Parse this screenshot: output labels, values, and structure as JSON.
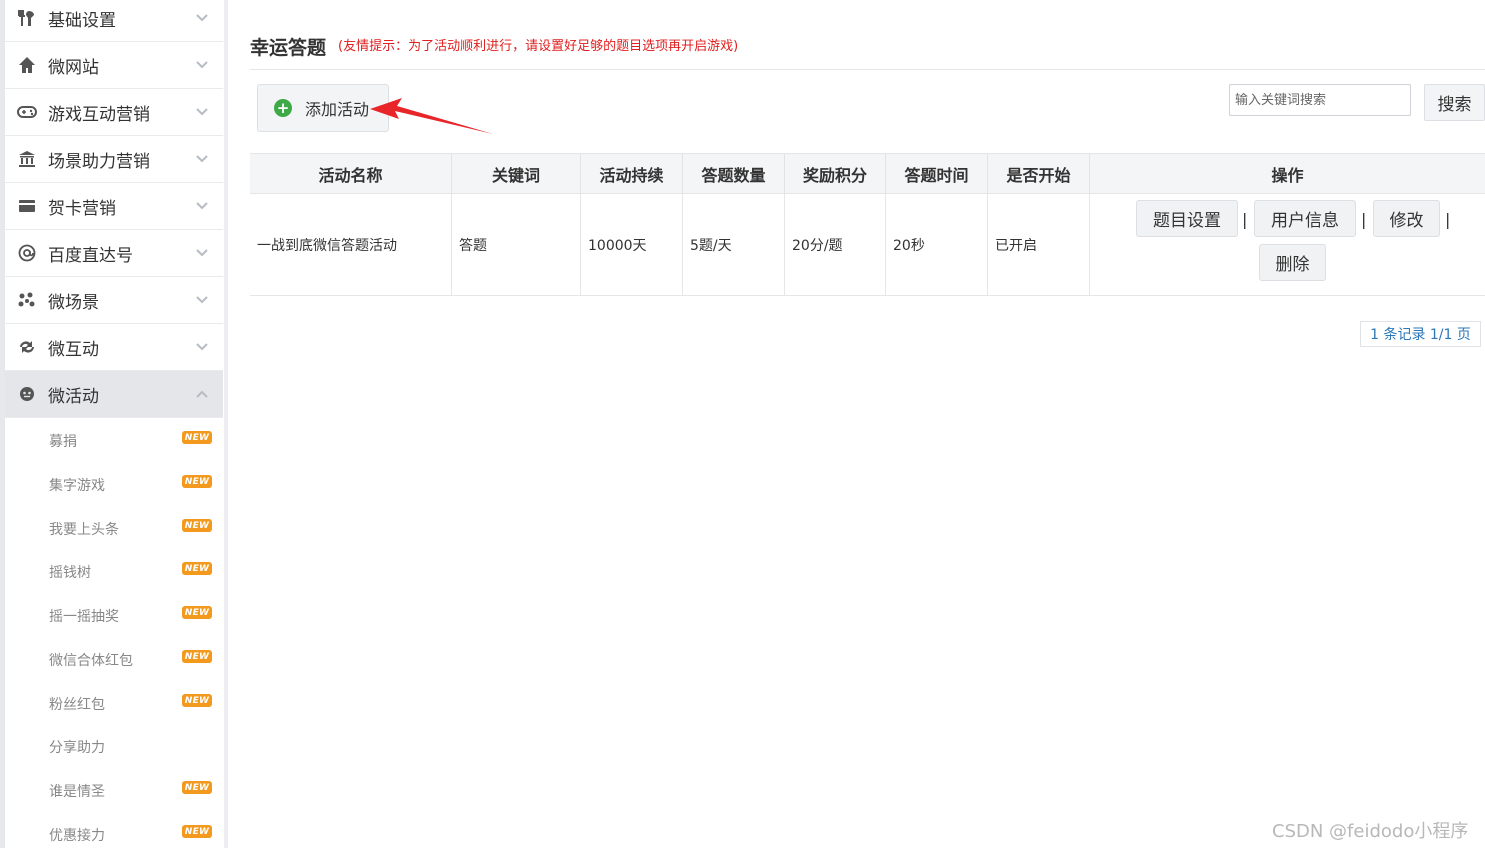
{
  "sidebar": {
    "menu": [
      {
        "label": "基础设置",
        "icon": "tools-icon"
      },
      {
        "label": "微网站",
        "icon": "home-icon"
      },
      {
        "label": "游戏互动营销",
        "icon": "gamepad-icon"
      },
      {
        "label": "场景助力营销",
        "icon": "bank-icon"
      },
      {
        "label": "贺卡营销",
        "icon": "card-icon"
      },
      {
        "label": "百度直达号",
        "icon": "at-icon"
      },
      {
        "label": "微场景",
        "icon": "dots-icon"
      },
      {
        "label": "微互动",
        "icon": "refresh-icon"
      },
      {
        "label": "微活动",
        "icon": "activity-icon"
      }
    ],
    "submenu": [
      {
        "label": "募捐",
        "badge": "NEW"
      },
      {
        "label": "集字游戏",
        "badge": "NEW"
      },
      {
        "label": "我要上头条",
        "badge": "NEW"
      },
      {
        "label": "摇钱树",
        "badge": "NEW"
      },
      {
        "label": "摇一摇抽奖",
        "badge": "NEW"
      },
      {
        "label": "微信合体红包",
        "badge": "NEW"
      },
      {
        "label": "粉丝红包",
        "badge": "NEW"
      },
      {
        "label": "分享助力",
        "badge": ""
      },
      {
        "label": "谁是情圣",
        "badge": "NEW"
      },
      {
        "label": "优惠接力",
        "badge": "NEW"
      }
    ]
  },
  "header": {
    "title": "幸运答题",
    "hint": "(友情提示：为了活动顺利进行，请设置好足够的题目选项再开启游戏)"
  },
  "toolbar": {
    "add_label": "添加活动",
    "search_placeholder": "输入关键词搜索",
    "search_label": "搜索"
  },
  "table": {
    "columns": [
      "活动名称",
      "关键词",
      "活动持续",
      "答题数量",
      "奖励积分",
      "答题时间",
      "是否开始",
      "操作"
    ],
    "rows": [
      {
        "name": "一战到底微信答题活动",
        "keyword": "答题",
        "duration": "10000天",
        "count": "5题/天",
        "points": "20分/题",
        "time": "20秒",
        "started": "已开启"
      }
    ],
    "actions": {
      "questions": "题目设置",
      "users": "用户信息",
      "edit": "修改",
      "delete": "删除",
      "separator": "|"
    }
  },
  "pagination": {
    "text": "1 条记录 1/1 页"
  },
  "watermark": "CSDN @feidodo小程序",
  "colors": {
    "hint": "#e02020",
    "badge": "#f39a1e",
    "add_icon": "#3daa47",
    "arrow": "#e8262a",
    "pagination": "#2b77b8"
  }
}
